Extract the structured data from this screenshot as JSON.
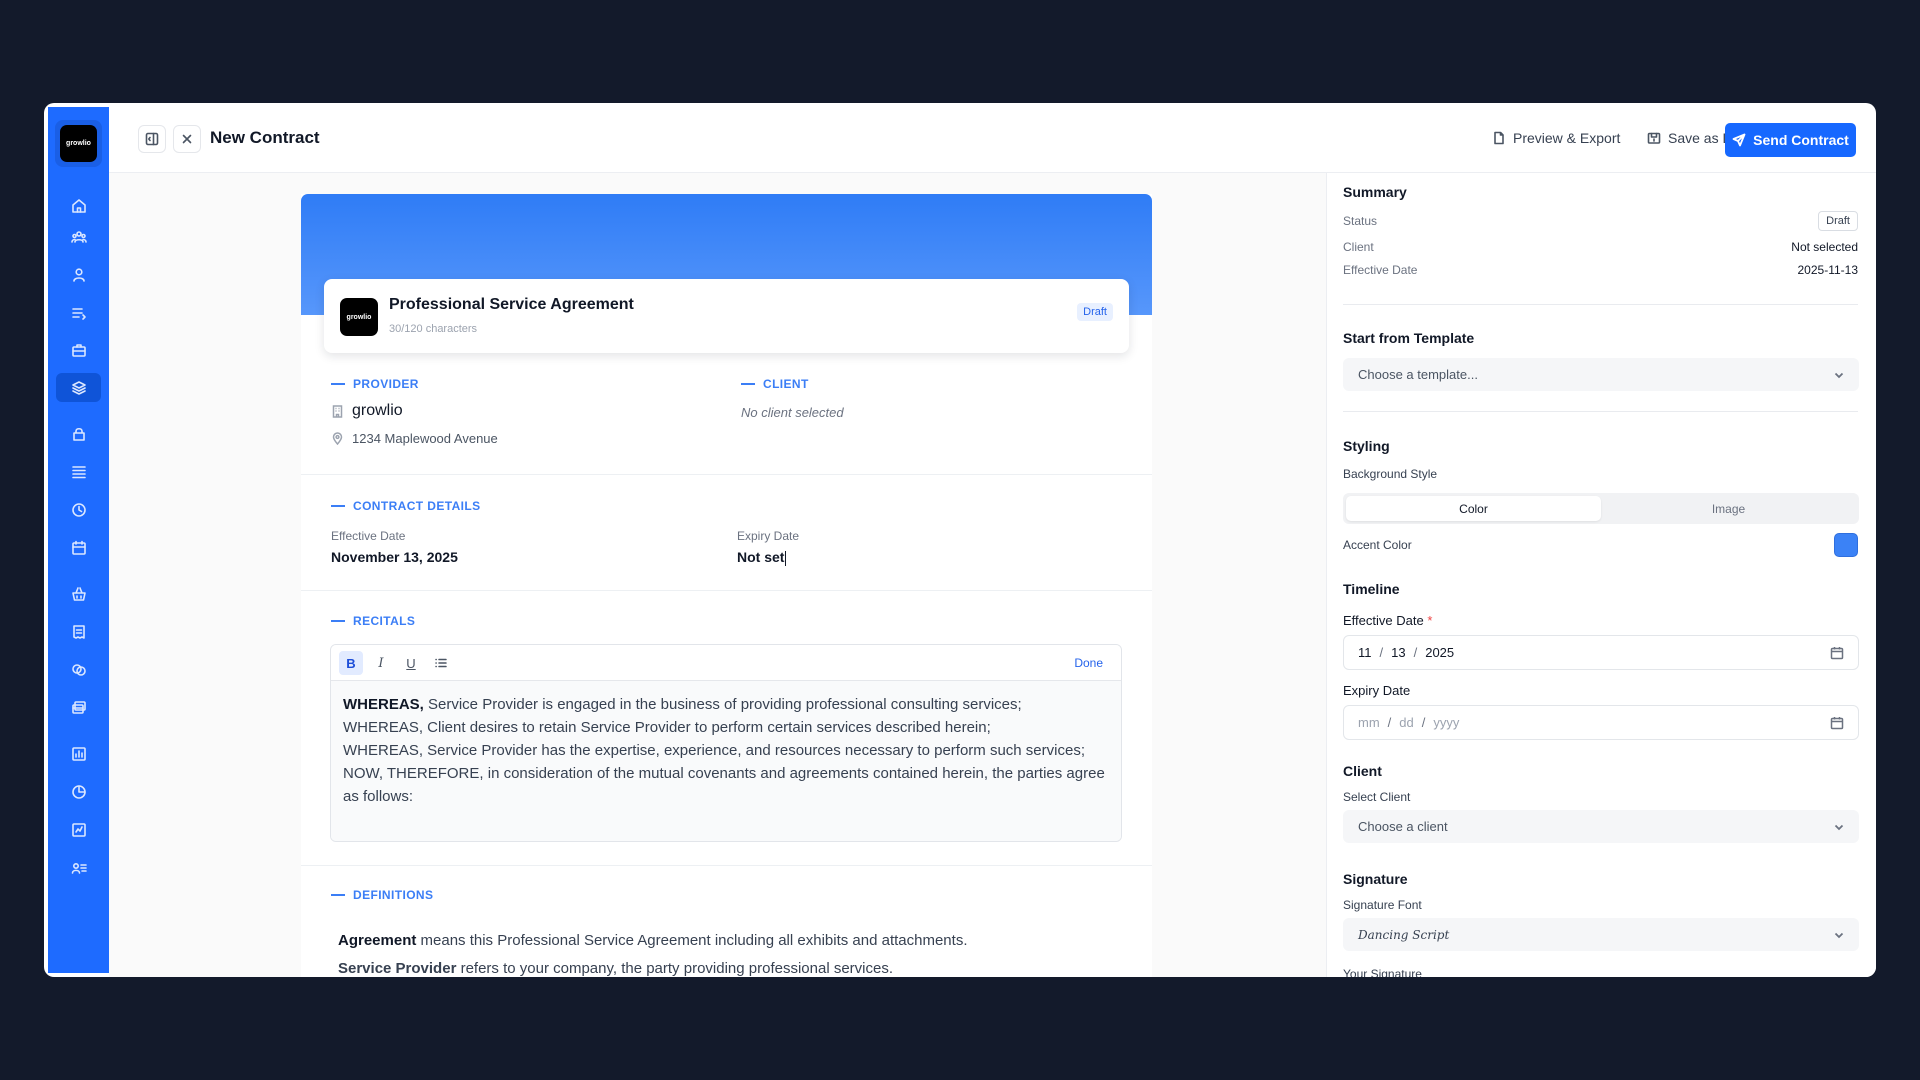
{
  "app": {
    "logo_text": "growlio"
  },
  "header": {
    "title": "New Contract",
    "preview_label": "Preview & Export",
    "save_label": "Save as Draft",
    "send_label": "Send Contract"
  },
  "sidebar": {
    "items": [
      {
        "icon": "home-icon"
      },
      {
        "icon": "team-icon"
      },
      {
        "icon": "user-icon"
      },
      {
        "icon": "list-icon"
      },
      {
        "icon": "briefcase-icon"
      },
      {
        "icon": "layers-icon",
        "active": true
      },
      {
        "icon": "bag-icon"
      },
      {
        "icon": "menu-icon"
      },
      {
        "icon": "clock-icon"
      },
      {
        "icon": "calendar-icon"
      },
      {
        "icon": "basket-icon"
      },
      {
        "icon": "receipt-icon"
      },
      {
        "icon": "coins-icon"
      },
      {
        "icon": "cards-icon"
      },
      {
        "icon": "chart-icon"
      },
      {
        "icon": "pie-icon"
      },
      {
        "icon": "report-icon"
      },
      {
        "icon": "users-list-icon"
      }
    ]
  },
  "document": {
    "title": "Professional Service Agreement",
    "char_count": "30/120 characters",
    "status": "Draft",
    "provider_label": "PROVIDER",
    "provider_name": "growlio",
    "provider_address": "1234 Maplewood Avenue",
    "client_label": "CLIENT",
    "client_empty": "No client selected",
    "details_label": "CONTRACT DETAILS",
    "effective_label": "Effective Date",
    "effective_value": "November 13, 2025",
    "expiry_label": "Expiry Date",
    "expiry_value": "Not set",
    "recitals_label": "RECITALS",
    "editor_done": "Done",
    "recitals": {
      "lead": "WHEREAS,",
      "line1": " Service Provider is engaged in the business of providing professional consulting services;",
      "line2": "WHEREAS, Client desires to retain Service Provider to perform certain services described herein;",
      "line3": "WHEREAS, Service Provider has the expertise, experience, and resources necessary to perform such services;",
      "line4": "NOW, THEREFORE, in consideration of the mutual covenants and agreements contained herein, the parties agree as follows:"
    },
    "definitions_label": "DEFINITIONS",
    "def1_term": "Agreement",
    "def1_text": " means this Professional Service Agreement including all exhibits and attachments.",
    "def2_term": "Service Provider",
    "def2_text": " refers to your company, the party providing professional services."
  },
  "panel": {
    "summary_title": "Summary",
    "status_label": "Status",
    "status_value": "Draft",
    "client_label": "Client",
    "client_value": "Not selected",
    "eff_label": "Effective Date",
    "eff_value": "2025-11-13",
    "template_title": "Start from Template",
    "template_placeholder": "Choose a template...",
    "styling_title": "Styling",
    "bg_style_label": "Background Style",
    "bg_color": "Color",
    "bg_image": "Image",
    "accent_label": "Accent Color",
    "accent_color": "#3b82f6",
    "timeline_title": "Timeline",
    "eff_date_label": "Effective Date",
    "required_mark": "*",
    "eff_mm": "11",
    "eff_dd": "13",
    "eff_yyyy": "2025",
    "expiry_label": "Expiry Date",
    "exp_mm": "mm",
    "exp_dd": "dd",
    "exp_yyyy": "yyyy",
    "client_title": "Client",
    "select_client_label": "Select Client",
    "client_placeholder": "Choose a client",
    "signature_title": "Signature",
    "sig_font_label": "Signature Font",
    "sig_font_value": "Dancing Script",
    "your_signature_label": "Your Signature"
  }
}
